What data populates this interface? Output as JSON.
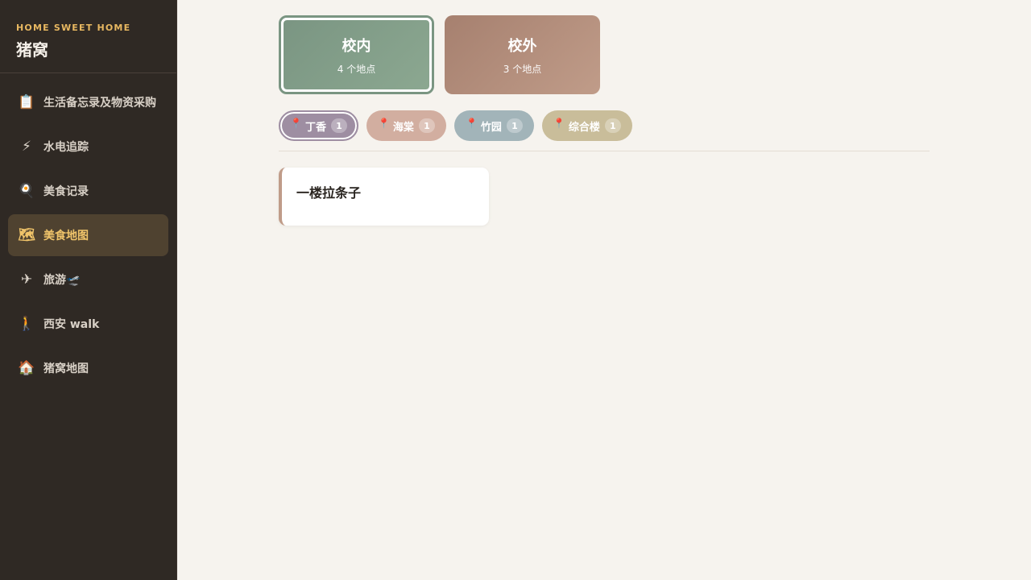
{
  "brand": {
    "tag": "HOME SWEET HOME",
    "title": "猪窝"
  },
  "nav": [
    {
      "icon": "📋",
      "label": "生活备忘录及物资采购",
      "active": false
    },
    {
      "icon": "⚡",
      "label": "水电追踪",
      "active": false
    },
    {
      "icon": "🍳",
      "label": "美食记录",
      "active": false
    },
    {
      "icon": "🗺",
      "label": "美食地图",
      "active": true
    },
    {
      "icon": "✈",
      "label": "旅游🛫",
      "active": false
    },
    {
      "icon": "🚶",
      "label": "西安 walk",
      "active": false
    },
    {
      "icon": "🏠",
      "label": "猪窝地图",
      "active": false
    }
  ],
  "zones": [
    {
      "title": "校内",
      "subtitle": "4 个地点",
      "selected": true
    },
    {
      "title": "校外",
      "subtitle": "3 个地点",
      "selected": false
    }
  ],
  "locations": [
    {
      "name": "丁香",
      "count": "1",
      "color": "#9e8ea2",
      "selected": true
    },
    {
      "name": "海棠",
      "count": "1",
      "color": "#d2aea0",
      "selected": false
    },
    {
      "name": "竹园",
      "count": "1",
      "color": "#a2b4b9",
      "selected": false
    },
    {
      "name": "综合楼",
      "count": "1",
      "color": "#c9bd9a",
      "selected": false
    }
  ],
  "spots": [
    {
      "name": "一楼拉条子"
    }
  ],
  "colors": {
    "sidebar": "#2f2924",
    "accent": "#f0c46a",
    "background": "#f6f3ee"
  }
}
